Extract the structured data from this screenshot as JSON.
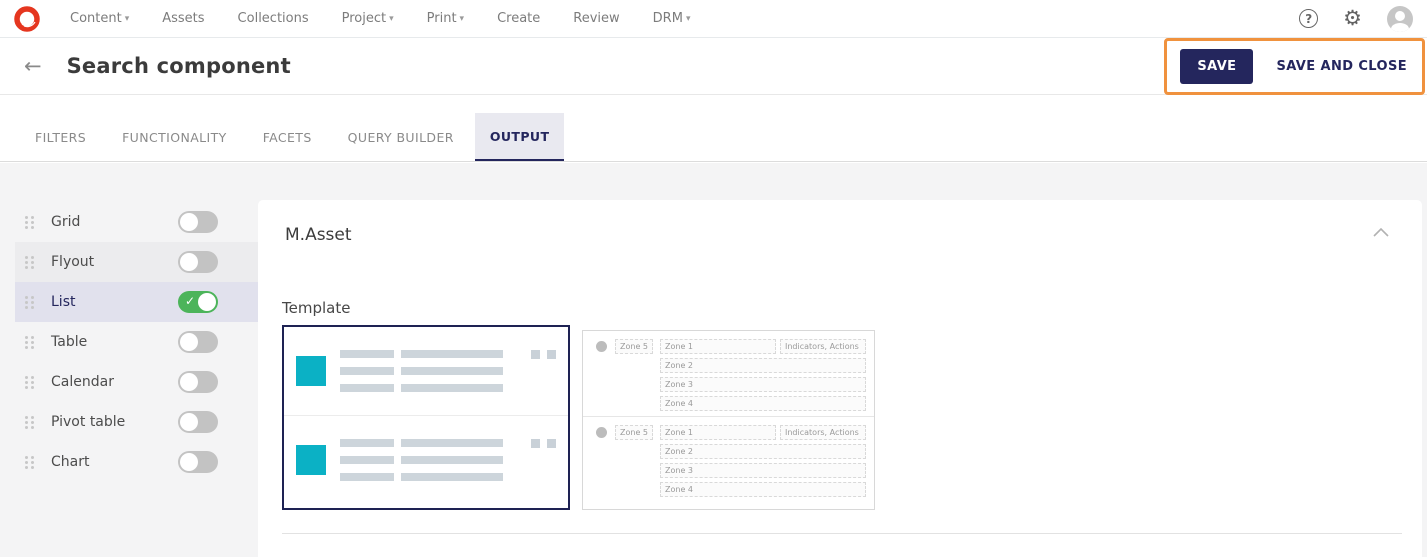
{
  "nav": {
    "items": [
      {
        "label": "Content",
        "dropdown": true
      },
      {
        "label": "Assets",
        "dropdown": false
      },
      {
        "label": "Collections",
        "dropdown": false
      },
      {
        "label": "Project",
        "dropdown": true
      },
      {
        "label": "Print",
        "dropdown": true
      },
      {
        "label": "Create",
        "dropdown": false
      },
      {
        "label": "Review",
        "dropdown": false
      },
      {
        "label": "DRM",
        "dropdown": true
      }
    ]
  },
  "icons": {
    "caret_down": "▾",
    "help": "?",
    "gear": "⚙",
    "back_arrow": "←",
    "check": "✓"
  },
  "header": {
    "title": "Search component",
    "save_label": "SAVE",
    "save_and_close_label": "SAVE AND CLOSE"
  },
  "tabs": [
    {
      "label": "FILTERS",
      "active": false
    },
    {
      "label": "FUNCTIONALITY",
      "active": false
    },
    {
      "label": "FACETS",
      "active": false
    },
    {
      "label": "QUERY BUILDER",
      "active": false
    },
    {
      "label": "OUTPUT",
      "active": true
    }
  ],
  "sidebar": {
    "items": [
      {
        "label": "Grid",
        "enabled": false,
        "highlight": ""
      },
      {
        "label": "Flyout",
        "enabled": false,
        "highlight": "hover"
      },
      {
        "label": "List",
        "enabled": true,
        "highlight": "selected"
      },
      {
        "label": "Table",
        "enabled": false,
        "highlight": ""
      },
      {
        "label": "Calendar",
        "enabled": false,
        "highlight": ""
      },
      {
        "label": "Pivot table",
        "enabled": false,
        "highlight": ""
      },
      {
        "label": "Chart",
        "enabled": false,
        "highlight": ""
      }
    ]
  },
  "main": {
    "section_title": "M.Asset",
    "template_label": "Template",
    "zone_preview": {
      "zone_side": "Zone 5",
      "zone1": "Zone 1",
      "zone2": "Zone 2",
      "zone3": "Zone 3",
      "zone4": "Zone 4",
      "indicators": "Indicators, Actions"
    }
  },
  "colors": {
    "navy": "#24265d",
    "highlight_orange": "#f0923e",
    "toggle_green": "#4cb45a",
    "preview_cyan": "#0bb1c5",
    "logo_red": "#e5361f",
    "selected_row": "#e1e1ed"
  }
}
